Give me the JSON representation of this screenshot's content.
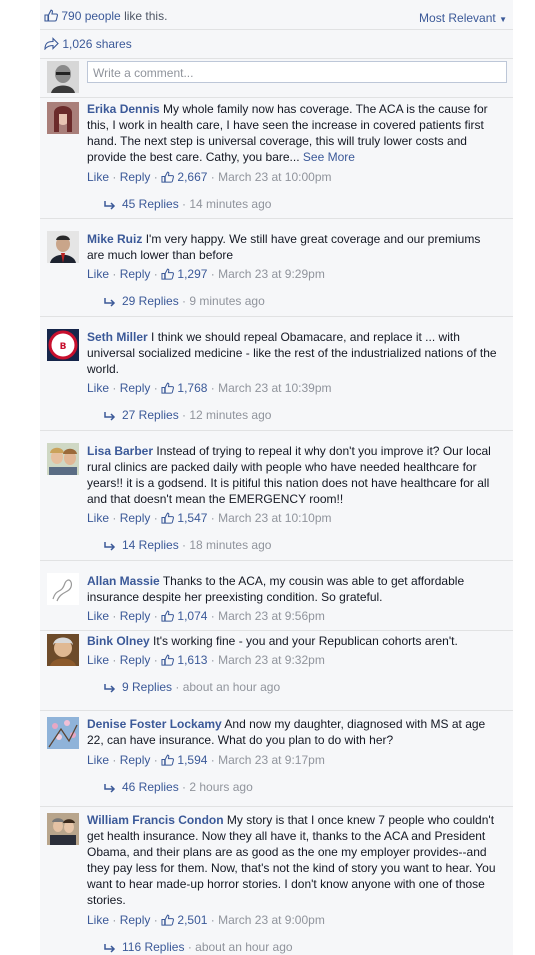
{
  "header": {
    "likes_count": "790 people",
    "likes_suffix": " like this.",
    "sort_label": "Most Relevant",
    "shares": "1,026 shares"
  },
  "composer": {
    "placeholder": "Write a comment..."
  },
  "comments": [
    {
      "author": "Erika Dennis",
      "text": "My whole family now has coverage. The ACA is the cause for this, I work in health care, I have seen the increase in covered patients first hand. The next step is universal coverage, this will truly lower costs and provide the best care. Cathy, you bare...",
      "see_more": "See More",
      "likes": "2,667",
      "time": "March 23 at 10:00pm",
      "replies": "45 Replies",
      "replies_time": "14 minutes ago"
    },
    {
      "author": "Mike Ruiz",
      "text": "I'm very happy. We still have great coverage and our premiums are much lower than before",
      "likes": "1,297",
      "time": "March 23 at 9:29pm",
      "replies": "29 Replies",
      "replies_time": "9 minutes ago"
    },
    {
      "author": "Seth Miller",
      "text": "I think we should repeal Obamacare, and replace it ... with universal socialized medicine - like the rest of the industrialized nations of the world.",
      "likes": "1,768",
      "time": "March 23 at 10:39pm",
      "replies": "27 Replies",
      "replies_time": "12 minutes ago"
    },
    {
      "author": "Lisa Barber",
      "text": "Instead of trying to repeal it why don't you improve it? Our local rural clinics are packed daily with people who have needed healthcare for years!! it is a godsend. It is pitiful this nation does not have healthcare for all and that doesn't mean the EMERGENCY room!!",
      "likes": "1,547",
      "time": "March 23 at 10:10pm",
      "replies": "14 Replies",
      "replies_time": "18 minutes ago"
    },
    {
      "author": "Allan Massie",
      "text": "Thanks to the ACA, my cousin was able to get affordable insurance despite her preexisting condition. So grateful.",
      "likes": "1,074",
      "time": "March 23 at 9:56pm"
    },
    {
      "author": "Bink Olney",
      "text": "It's working fine - you and your Republican cohorts aren't.",
      "likes": "1,613",
      "time": "March 23 at 9:32pm",
      "replies": "9 Replies",
      "replies_time": "about an hour ago"
    },
    {
      "author": "Denise Foster Lockamy",
      "text": "And now my daughter, diagnosed with MS at age 22, can have insurance. What do you plan to do with her?",
      "likes": "1,594",
      "time": "March 23 at 9:17pm",
      "replies": "46 Replies",
      "replies_time": "2 hours ago"
    },
    {
      "author": "William Francis Condon",
      "text": "My story is that I once knew 7 people who couldn't get health insurance. Now they all have it, thanks to the ACA and President Obama, and their plans are as good as the one my employer provides--and they pay less for them. Now, that's not the kind of story you want to hear. You want to hear made-up horror stories. I don't know anyone with one of those stories.",
      "likes": "2,501",
      "time": "March 23 at 9:00pm",
      "replies": "116 Replies",
      "replies_time": "about an hour ago"
    }
  ],
  "actions": {
    "like": "Like",
    "reply": "Reply",
    "sep": " · "
  }
}
